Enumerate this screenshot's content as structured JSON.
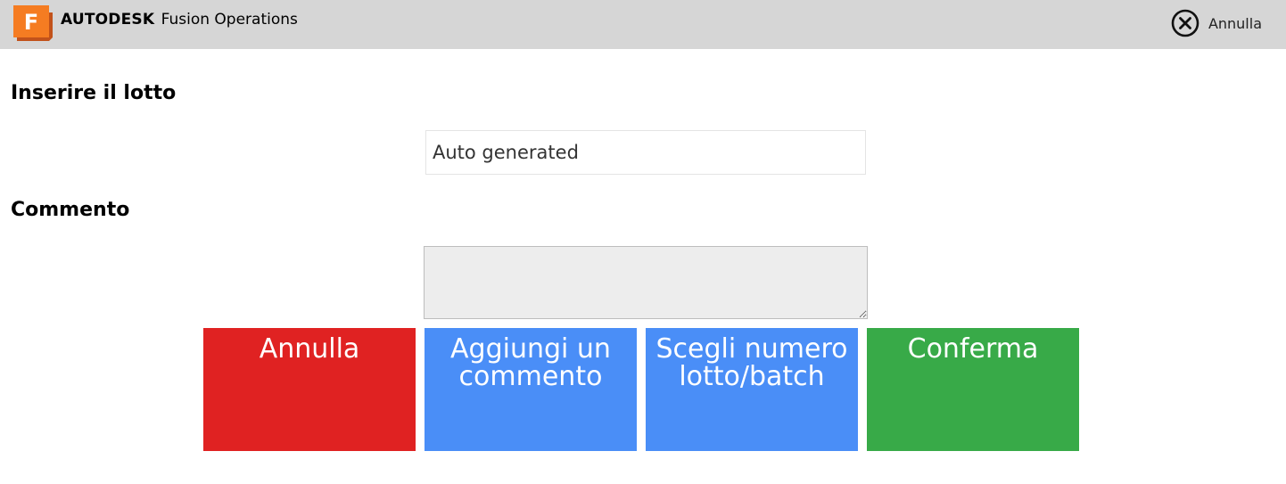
{
  "header": {
    "company": "AUTODESK",
    "product": "Fusion Operations",
    "logo_letter": "F",
    "logo_color": "#f57c22",
    "cancel_label": "Annulla",
    "cancel_icon": "close-circle-icon"
  },
  "form": {
    "lot_label": "Inserire il lotto",
    "lot_value": "Auto generated",
    "comment_label": "Commento",
    "comment_value": ""
  },
  "buttons": {
    "cancel": "Annulla",
    "add_comment": "Aggiungi un commento",
    "choose_lot": "Scegli numero lotto/batch",
    "confirm": "Conferma"
  },
  "colors": {
    "topbar": "#d6d6d6",
    "cancel": "#e02222",
    "action": "#4a8ef7",
    "confirm": "#38aa48"
  }
}
